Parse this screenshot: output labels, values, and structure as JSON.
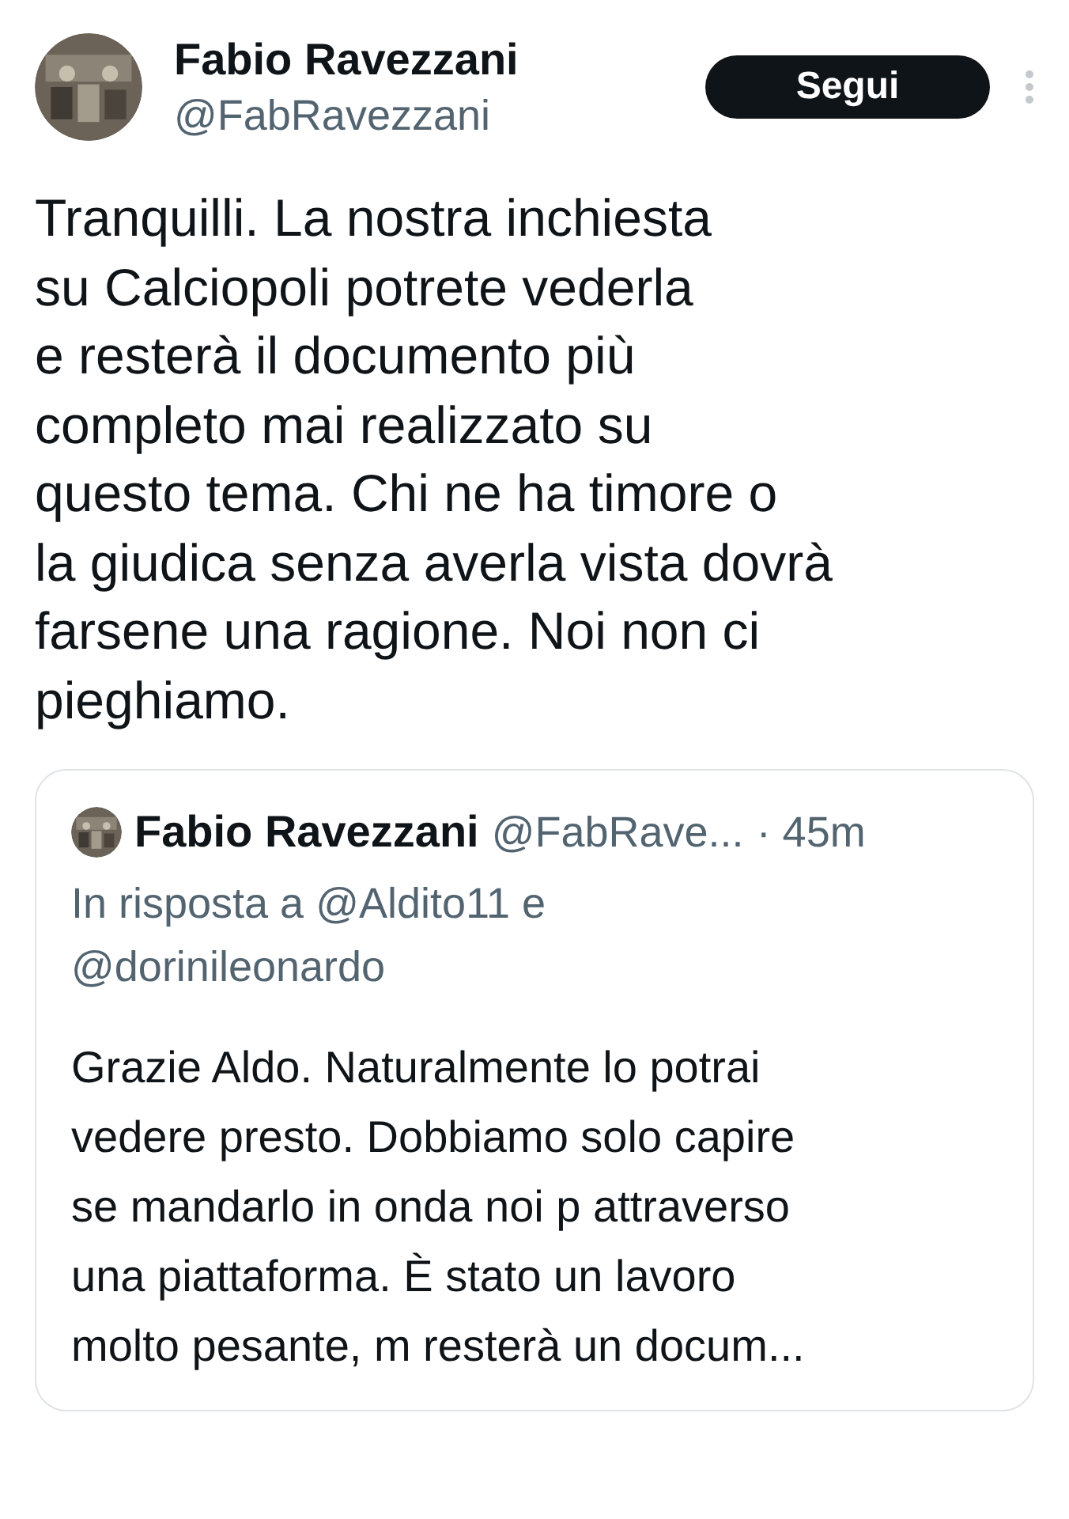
{
  "author": {
    "name": "Fabio Ravezzani",
    "handle": "@FabRavezzani"
  },
  "follow_button": {
    "label": "Segui"
  },
  "text": "Tranquilli. La nostra inchiesta\nsu Calciopoli potrete vederla\ne resterà il documento più\ncompleto mai realizzato su\nquesto tema. Chi ne ha timore o\nla giudica senza averla vista dovrà\nfarsene una ragione. Noi non ci\npieghiamo.",
  "quoted": {
    "name": "Fabio Ravezzani",
    "handle": "@FabRave...",
    "time": "· 45m",
    "reply_to": "In risposta a @Aldito11 e\n@dorinileonardo",
    "text": "Grazie Aldo. Naturalmente lo potrai\nvedere presto. Dobbiamo solo capire\nse mandarlo in onda noi p attraverso\nuna piattaforma. È stato un lavoro\nmolto pesante, m resterà un docum..."
  }
}
